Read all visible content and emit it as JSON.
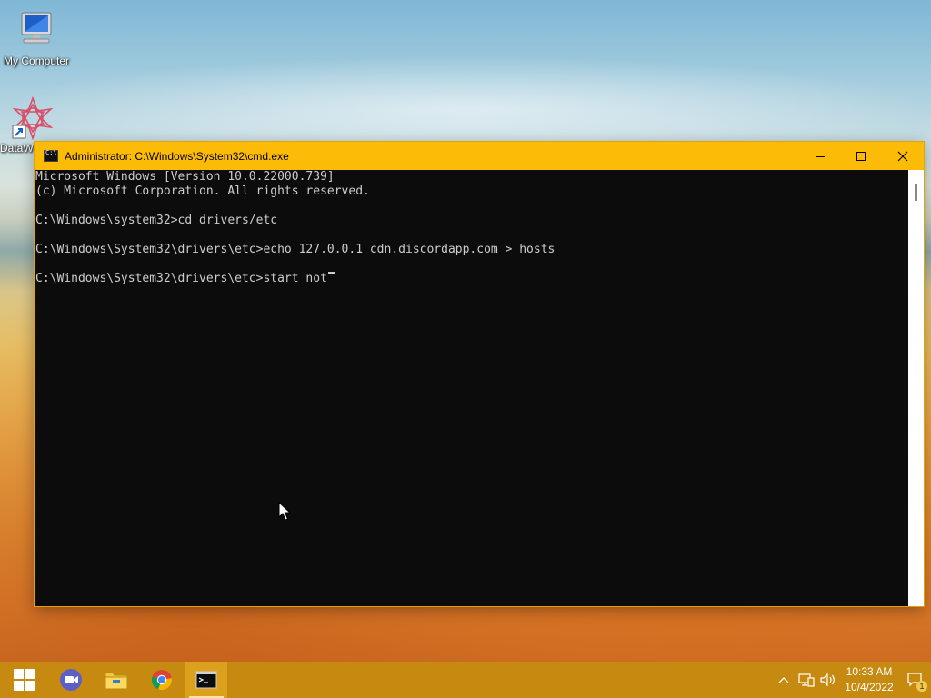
{
  "desktop": {
    "icons": [
      {
        "label": "My Computer",
        "icon": "computer-icon"
      },
      {
        "label": "DataW",
        "icon": "datawatch-shortcut-icon"
      }
    ]
  },
  "cmd_window": {
    "title": "Administrator: C:\\Windows\\System32\\cmd.exe",
    "lines": [
      "Microsoft Windows [Version 10.0.22000.739]",
      "(c) Microsoft Corporation. All rights reserved.",
      "",
      "C:\\Windows\\system32>cd drivers/etc",
      "",
      "C:\\Windows\\System32\\drivers\\etc>echo 127.0.0.1 cdn.discordapp.com > hosts",
      "",
      "C:\\Windows\\System32\\drivers\\etc>start not"
    ],
    "titlebar_color": "#fcbb06"
  },
  "taskbar": {
    "color": "#c68a10",
    "apps": [
      {
        "name": "start",
        "icon": "windows-start-icon"
      },
      {
        "name": "video-call",
        "icon": "video-camera-icon"
      },
      {
        "name": "file-explorer",
        "icon": "folder-icon"
      },
      {
        "name": "chrome",
        "icon": "chrome-icon"
      },
      {
        "name": "command-prompt",
        "icon": "cmd-icon",
        "active": true
      }
    ],
    "tray": {
      "time": "10:33 AM",
      "date": "10/4/2022",
      "notification_count": "1"
    }
  }
}
